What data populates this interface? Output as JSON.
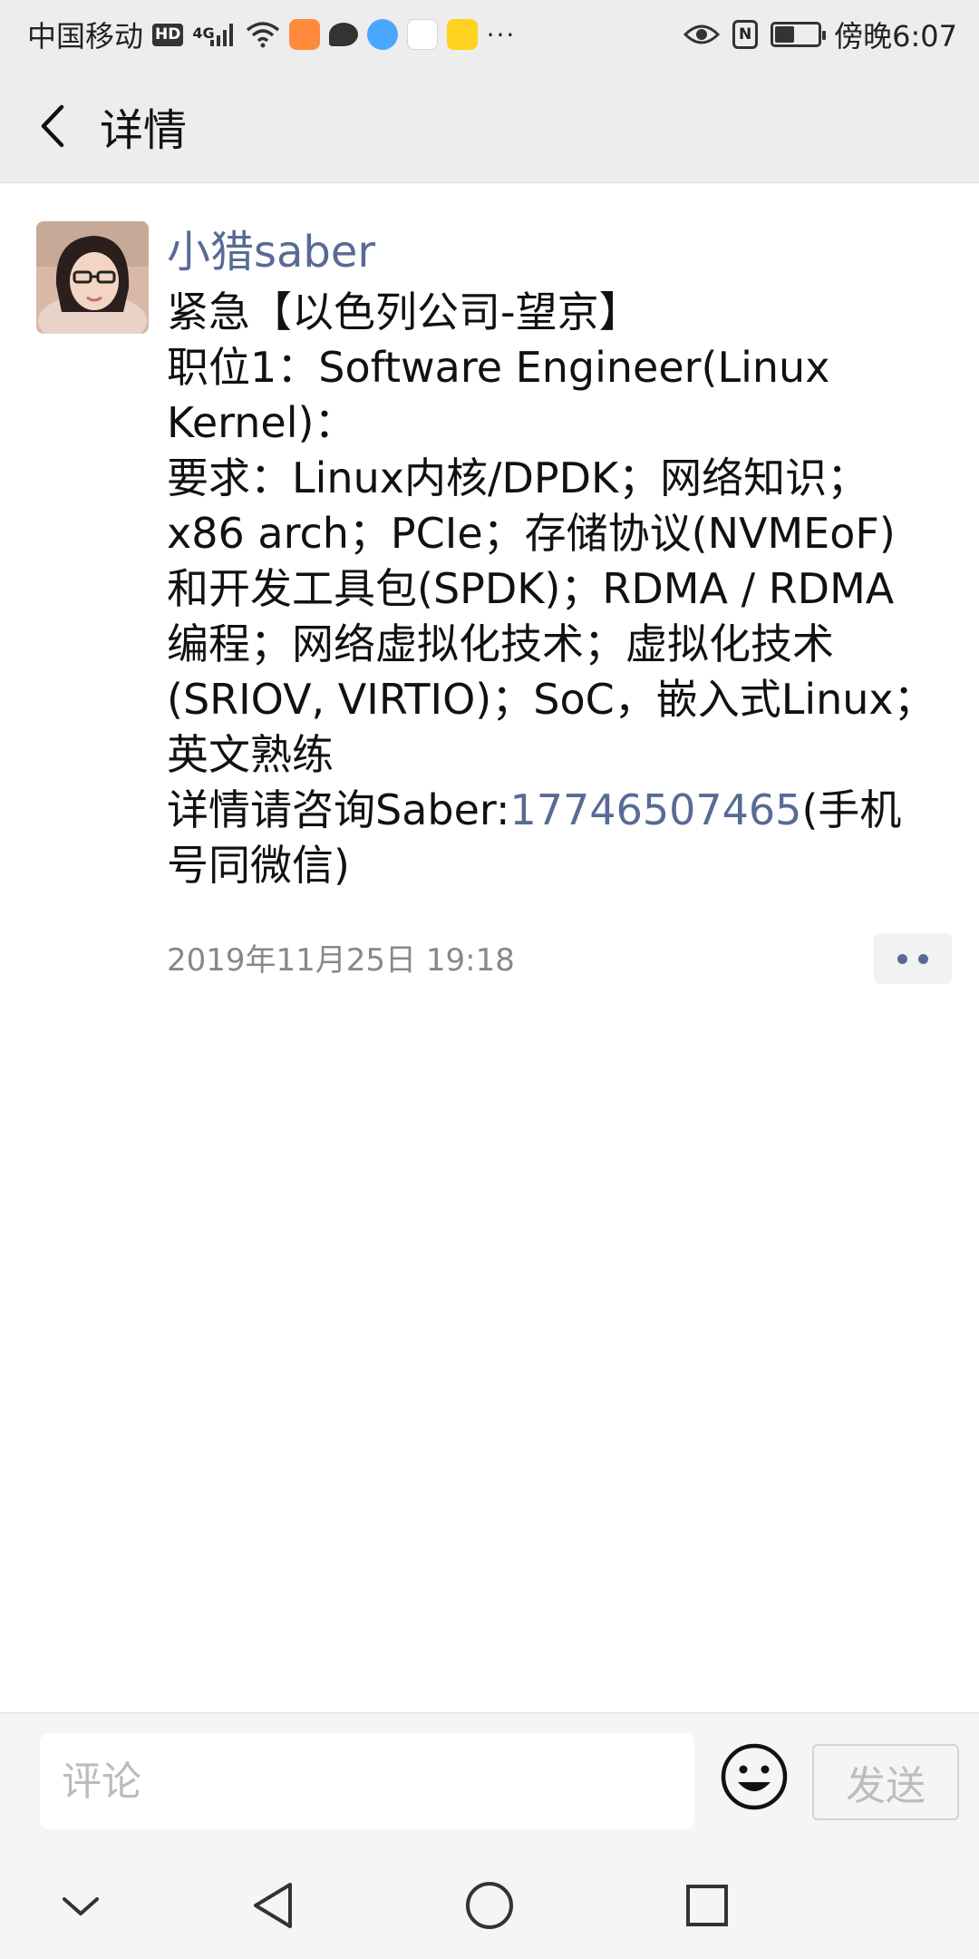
{
  "status_bar": {
    "carrier": "中国移动",
    "hd_badge": "HD",
    "network": "4G",
    "more_dots": "···",
    "nfc_label": "N",
    "battery_level": 0.45,
    "time": "傍晚6:07",
    "icons": [
      "signal-icon",
      "wifi-icon",
      "video-app-icon",
      "message-icon",
      "k-app-icon",
      "app-icon",
      "app-icon",
      "eye-icon",
      "nfc-icon",
      "battery-icon"
    ]
  },
  "header": {
    "title": "详情",
    "back_icon": "chevron-left-icon"
  },
  "post": {
    "author": "小猎saber",
    "content_lines": [
      "紧急【以色列公司-望京】",
      "职位1：Software Engineer(Linux",
      "Kernel)：",
      "要求：Linux内核/DPDK；网络知识；",
      "x86 arch；PCIe；存储协议(NVMEoF)",
      "和开发工具包(SPDK)；RDMA / RDMA",
      "编程；网络虚拟化技术；虚拟化技术",
      "(SRIOV, VIRTIO)；SoC，嵌入式Linux；",
      "英文熟练"
    ],
    "contact_prefix": "详情请咨询Saber:",
    "phone": "17746507465",
    "contact_suffix_1": "(手机",
    "contact_suffix_2": "号同微信)",
    "timestamp": "2019年11月25日 19:18",
    "link_color": "#576b95"
  },
  "comment_bar": {
    "placeholder": "评论",
    "value": "",
    "send_label": "发送",
    "emoji_icon": "smiley-icon"
  },
  "nav_bar": {
    "icons": [
      "chevron-down-icon",
      "back-triangle-icon",
      "home-circle-icon",
      "recents-square-icon"
    ]
  }
}
